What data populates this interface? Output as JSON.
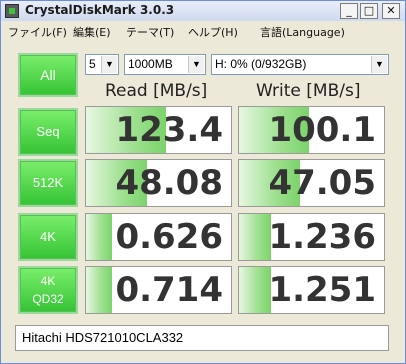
{
  "window": {
    "title": "CrystalDiskMark 3.0.3",
    "min_glyph": "_",
    "max_glyph": "□",
    "close_glyph": "✕"
  },
  "menu": [
    "ファイル(F)",
    "編集(E)",
    "テーマ(T)",
    "ヘルプ(H)",
    "言語(Language)"
  ],
  "controls": {
    "all_label": "All",
    "count": "5",
    "size": "1000MB",
    "drive": "H: 0% (0/932GB)"
  },
  "headers": {
    "read": "Read [MB/s]",
    "write": "Write [MB/s]"
  },
  "rows": [
    {
      "label": "Seq",
      "read": "123.4",
      "write": "100.1",
      "read_fill": 0.55,
      "write_fill": 0.48
    },
    {
      "label": "512K",
      "read": "48.08",
      "write": "47.05",
      "read_fill": 0.42,
      "write_fill": 0.42
    },
    {
      "label": "4K",
      "read": "0.626",
      "write": "1.236",
      "read_fill": 0.18,
      "write_fill": 0.22
    },
    {
      "label": "4K",
      "sublabel": "QD32",
      "read": "0.714",
      "write": "1.251",
      "read_fill": 0.18,
      "write_fill": 0.22
    }
  ],
  "drive_model": "Hitachi HDS721010CLA332",
  "colors": {
    "accent_green": "#35c335",
    "bar_green": "#7bd36b"
  }
}
